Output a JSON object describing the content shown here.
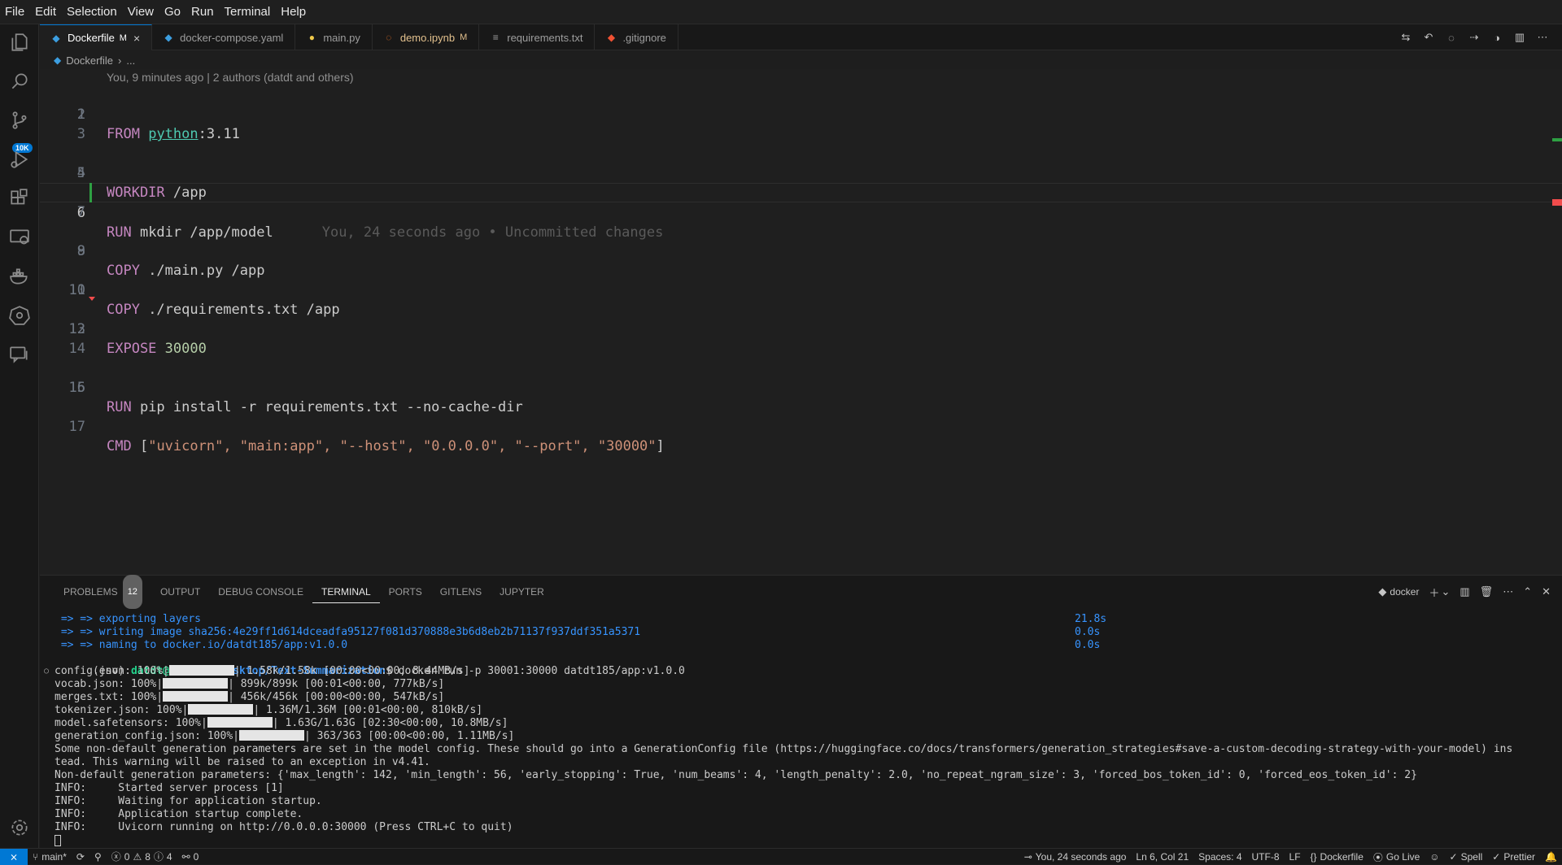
{
  "menu": [
    "File",
    "Edit",
    "Selection",
    "View",
    "Go",
    "Run",
    "Terminal",
    "Help"
  ],
  "activity": {
    "scm_badge": "10K"
  },
  "tabs": [
    {
      "label": "Dockerfile",
      "modified": "M",
      "close": "×"
    },
    {
      "label": "docker-compose.yaml"
    },
    {
      "label": "main.py"
    },
    {
      "label": "demo.ipynb",
      "modified": "M"
    },
    {
      "label": "requirements.txt"
    },
    {
      "label": ".gitignore"
    }
  ],
  "breadcrumb": {
    "file": "Dockerfile",
    "sep": "›",
    "more": "..."
  },
  "editor": {
    "blame_header": "You, 9 minutes ago | 2 authors (datdt and others)",
    "lines": [
      {
        "n": "1",
        "kw": "FROM",
        "rest": " ",
        "img": "python",
        "tail": ":3.11"
      },
      {
        "n": "2"
      },
      {
        "n": "3"
      },
      {
        "n": "4",
        "kw": "WORKDIR",
        "rest": " /app"
      },
      {
        "n": "5"
      },
      {
        "n": "6",
        "kw": "RUN",
        "rest": " mkdir /app/model",
        "blame": "You, 24 seconds ago • Uncommitted changes"
      },
      {
        "n": "7"
      },
      {
        "n": "8",
        "kw": "COPY",
        "rest": " ./main.py /app"
      },
      {
        "n": "9"
      },
      {
        "n": "10",
        "kw": "COPY",
        "rest": " ./requirements.txt /app"
      },
      {
        "n": "11"
      },
      {
        "n": "12",
        "kw": "EXPOSE",
        "rest": " ",
        "num": "30000"
      },
      {
        "n": "13"
      },
      {
        "n": "14"
      },
      {
        "n": "15",
        "kw": "RUN",
        "rest": " pip install -r requirements.txt --no-cache-dir"
      },
      {
        "n": "16"
      },
      {
        "n": "17",
        "kw": "CMD",
        "rest": " [",
        "str": "\"uvicorn\", \"main:app\", \"--host\", \"0.0.0.0\", \"--port\", \"30000\"",
        "end": "]"
      }
    ]
  },
  "panel": {
    "tabs": [
      "PROBLEMS",
      "OUTPUT",
      "DEBUG CONSOLE",
      "TERMINAL",
      "PORTS",
      "GITLENS",
      "JUPYTER"
    ],
    "problems_count": "12",
    "terminal_name": "docker"
  },
  "terminal": {
    "build_lines": [
      {
        "text": " => => exporting layers",
        "time": "21.8s"
      },
      {
        "text": " => => writing image sha256:4e29ff1d614dceadfa95127f081d370888e3b6d8eb2b71137f937ddf351a5371",
        "time": "0.0s"
      },
      {
        "text": " => => naming to docker.io/datdt185/app:v1.0.0",
        "time": "0.0s"
      }
    ],
    "prompt_env": "(env) ",
    "prompt_user": "datdt@datdt",
    "prompt_path": ":~/Desktop/Text-Summarization",
    "prompt_cmd": "$ docker run -p 30001:30000 datdt185/app:v1.0.0",
    "downloads": [
      {
        "pre": "config.json: 100%|",
        "bar": 80,
        "post": "| 1.58k/1.58k [00:00<00:00, 8.44MB/s]"
      },
      {
        "pre": "vocab.json: 100%|",
        "bar": 80,
        "post": "| 899k/899k [00:01<00:00, 777kB/s]"
      },
      {
        "pre": "merges.txt: 100%|",
        "bar": 80,
        "post": "| 456k/456k [00:00<00:00, 547kB/s]"
      },
      {
        "pre": "tokenizer.json: 100%|",
        "bar": 80,
        "post": "| 1.36M/1.36M [00:01<00:00, 810kB/s]"
      },
      {
        "pre": "model.safetensors: 100%|",
        "bar": 80,
        "post": "| 1.63G/1.63G [02:30<00:00, 10.8MB/s]"
      },
      {
        "pre": "generation_config.json: 100%|",
        "bar": 80,
        "post": "| 363/363 [00:00<00:00, 1.11MB/s]"
      }
    ],
    "messages": [
      "Some non-default generation parameters are set in the model config. These should go into a GenerationConfig file (https://huggingface.co/docs/transformers/generation_strategies#save-a-custom-decoding-strategy-with-your-model) ins",
      "tead. This warning will be raised to an exception in v4.41.",
      "Non-default generation parameters: {'max_length': 142, 'min_length': 56, 'early_stopping': True, 'num_beams': 4, 'length_penalty': 2.0, 'no_repeat_ngram_size': 3, 'forced_bos_token_id': 0, 'forced_eos_token_id': 2}",
      "INFO:     Started server process [1]",
      "INFO:     Waiting for application startup.",
      "INFO:     Application startup complete.",
      "INFO:     Uvicorn running on http://0.0.0.0:30000 (Press CTRL+C to quit)"
    ]
  },
  "status": {
    "branch": "main*",
    "errors": "0",
    "warnings": "8",
    "infos": "4",
    "ports": "0",
    "blame": "You, 24 seconds ago",
    "position": "Ln 6, Col 21",
    "spaces": "Spaces: 4",
    "encoding": "UTF-8",
    "eol": "LF",
    "language": "Dockerfile",
    "golive": "Go Live",
    "spell": "Spell",
    "prettier": "Prettier"
  },
  "colors": {
    "accent": "#0078d4",
    "keyword": "#c586c0",
    "string": "#ce9178",
    "type": "#4ec9b0"
  }
}
